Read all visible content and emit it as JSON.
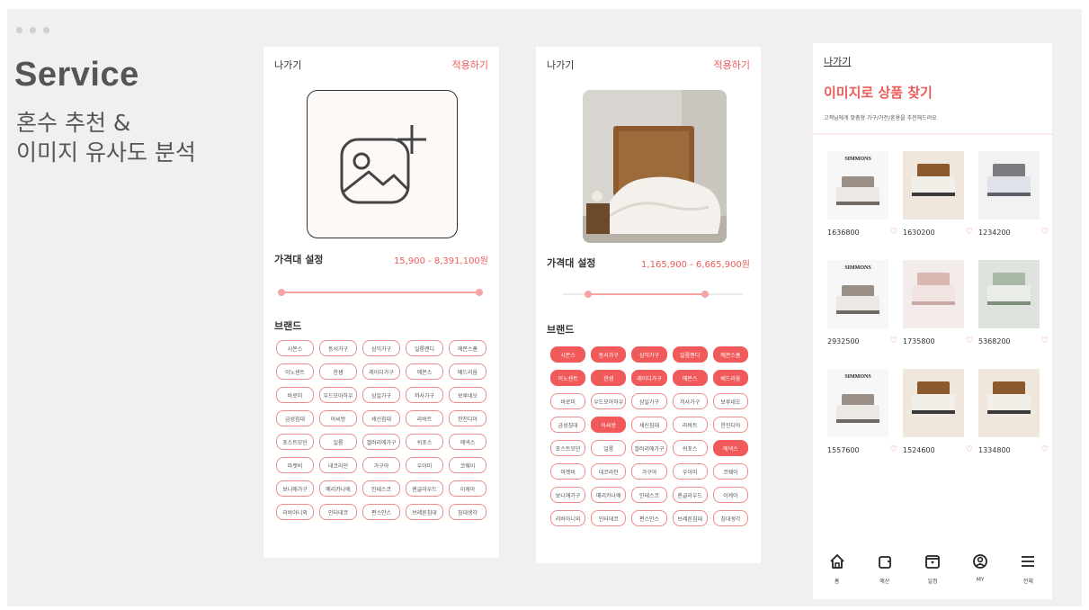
{
  "slide": {
    "heading": "Service",
    "subheading": "혼수 추천 &\n이미지 유사도 분석"
  },
  "screen1": {
    "back_label": "나가기",
    "apply_label": "적용하기",
    "upload_icon": "add-image-icon",
    "price_label": "가격대 설정",
    "price_range": "15,900 - 8,391,100원",
    "price_range_fraction": [
      0.0,
      1.0
    ],
    "brand_title": "브랜드",
    "brands": [
      {
        "name": "시몬스",
        "selected": false
      },
      {
        "name": "동서가구",
        "selected": false
      },
      {
        "name": "삼익가구",
        "selected": false
      },
      {
        "name": "일룸랜디",
        "selected": false
      },
      {
        "name": "에몬스홈",
        "selected": false
      },
      {
        "name": "이노센트",
        "selected": false
      },
      {
        "name": "한샘",
        "selected": false
      },
      {
        "name": "레이디가구",
        "selected": false
      },
      {
        "name": "에몬스",
        "selected": false
      },
      {
        "name": "베드리움",
        "selected": false
      },
      {
        "name": "바로미",
        "selected": false
      },
      {
        "name": "우드모아하우",
        "selected": false
      },
      {
        "name": "삼일가구",
        "selected": false
      },
      {
        "name": "까사가구",
        "selected": false
      },
      {
        "name": "보루네오",
        "selected": false
      },
      {
        "name": "금성침대",
        "selected": false
      },
      {
        "name": "아씨방",
        "selected": false
      },
      {
        "name": "세신침대",
        "selected": false
      },
      {
        "name": "라바트",
        "selected": false
      },
      {
        "name": "한진디아",
        "selected": false
      },
      {
        "name": "포스트모던",
        "selected": false
      },
      {
        "name": "일룸",
        "selected": false
      },
      {
        "name": "갤러리에가구",
        "selected": false
      },
      {
        "name": "쉬포스",
        "selected": false
      },
      {
        "name": "에넥스",
        "selected": false
      },
      {
        "name": "마켓비",
        "selected": false
      },
      {
        "name": "데코라인",
        "selected": false
      },
      {
        "name": "가구야",
        "selected": false
      },
      {
        "name": "우아미",
        "selected": false
      },
      {
        "name": "코웨이",
        "selected": false
      },
      {
        "name": "보니애가구",
        "selected": false
      },
      {
        "name": "메리카나에",
        "selected": false
      },
      {
        "name": "인테스코",
        "selected": false
      },
      {
        "name": "퀸글라우드",
        "selected": false
      },
      {
        "name": "이케아",
        "selected": false
      },
      {
        "name": "리바아니외",
        "selected": false
      },
      {
        "name": "인터데코",
        "selected": false
      },
      {
        "name": "편스안스",
        "selected": false
      },
      {
        "name": "브레른침대",
        "selected": false
      },
      {
        "name": "침대생각",
        "selected": false
      }
    ]
  },
  "screen2": {
    "back_label": "나가기",
    "apply_label": "적용하기",
    "price_label": "가격대 설정",
    "price_range": "1,165,900 - 6,665,900원",
    "price_range_fraction": [
      0.14,
      0.79
    ],
    "brand_title": "브랜드",
    "brands": [
      {
        "name": "시몬스",
        "selected": true
      },
      {
        "name": "동서가구",
        "selected": true
      },
      {
        "name": "삼익가구",
        "selected": true
      },
      {
        "name": "일룸랜디",
        "selected": true
      },
      {
        "name": "에몬스홈",
        "selected": true
      },
      {
        "name": "이노센트",
        "selected": true
      },
      {
        "name": "한샘",
        "selected": true
      },
      {
        "name": "레이디가구",
        "selected": true
      },
      {
        "name": "에몬스",
        "selected": true
      },
      {
        "name": "베드리움",
        "selected": true
      },
      {
        "name": "바로미",
        "selected": false
      },
      {
        "name": "우드모아하우",
        "selected": false
      },
      {
        "name": "삼일가구",
        "selected": false
      },
      {
        "name": "까사가구",
        "selected": false
      },
      {
        "name": "보루네오",
        "selected": false
      },
      {
        "name": "금성침대",
        "selected": false
      },
      {
        "name": "아씨방",
        "selected": true
      },
      {
        "name": "세신침대",
        "selected": false
      },
      {
        "name": "라바트",
        "selected": false
      },
      {
        "name": "한진디아",
        "selected": false
      },
      {
        "name": "포스트모던",
        "selected": false
      },
      {
        "name": "일룸",
        "selected": false
      },
      {
        "name": "갤러리에가구",
        "selected": false
      },
      {
        "name": "쉬포스",
        "selected": false
      },
      {
        "name": "에넥스",
        "selected": true
      },
      {
        "name": "마켓비",
        "selected": false
      },
      {
        "name": "데코라인",
        "selected": false
      },
      {
        "name": "가구야",
        "selected": false
      },
      {
        "name": "우아미",
        "selected": false
      },
      {
        "name": "코웨이",
        "selected": false
      },
      {
        "name": "보니애가구",
        "selected": false
      },
      {
        "name": "메리카나에",
        "selected": false
      },
      {
        "name": "인테스코",
        "selected": false
      },
      {
        "name": "퀸글라우드",
        "selected": false
      },
      {
        "name": "이케아",
        "selected": false
      },
      {
        "name": "리바아니외",
        "selected": false
      },
      {
        "name": "인터데코",
        "selected": false
      },
      {
        "name": "편스안스",
        "selected": false
      },
      {
        "name": "브레른침대",
        "selected": false
      },
      {
        "name": "침대생각",
        "selected": false
      }
    ]
  },
  "screen3": {
    "back_label": "나가기",
    "title": "이미지로 상품 찾기",
    "description": "고객님에게 맞춤형 가구/가전/혼용을 추천해드려요",
    "products": [
      {
        "price": "1636800",
        "brand_text": "SIMMONS",
        "style": "white"
      },
      {
        "price": "1630200",
        "brand_text": "",
        "style": "wood"
      },
      {
        "price": "1234200",
        "brand_text": "",
        "style": "grey"
      },
      {
        "price": "2932500",
        "brand_text": "SIMMONS",
        "style": "white"
      },
      {
        "price": "1735800",
        "brand_text": "",
        "style": "pink"
      },
      {
        "price": "5368200",
        "brand_text": "",
        "style": "green"
      },
      {
        "price": "1557600",
        "brand_text": "SIMMONS",
        "style": "white"
      },
      {
        "price": "1524600",
        "brand_text": "",
        "style": "wood"
      },
      {
        "price": "1334800",
        "brand_text": "",
        "style": "wood"
      }
    ],
    "tabs": [
      {
        "label": "홈",
        "icon": "home-icon"
      },
      {
        "label": "예산",
        "icon": "wallet-icon"
      },
      {
        "label": "일정",
        "icon": "calendar-icon"
      },
      {
        "label": "MY",
        "icon": "user-icon"
      },
      {
        "label": "전체",
        "icon": "menu-icon"
      }
    ]
  },
  "colors": {
    "accent": "#ef5a5a",
    "accent_light": "#f6a3a3",
    "slide_bg": "#f0f0f0"
  }
}
